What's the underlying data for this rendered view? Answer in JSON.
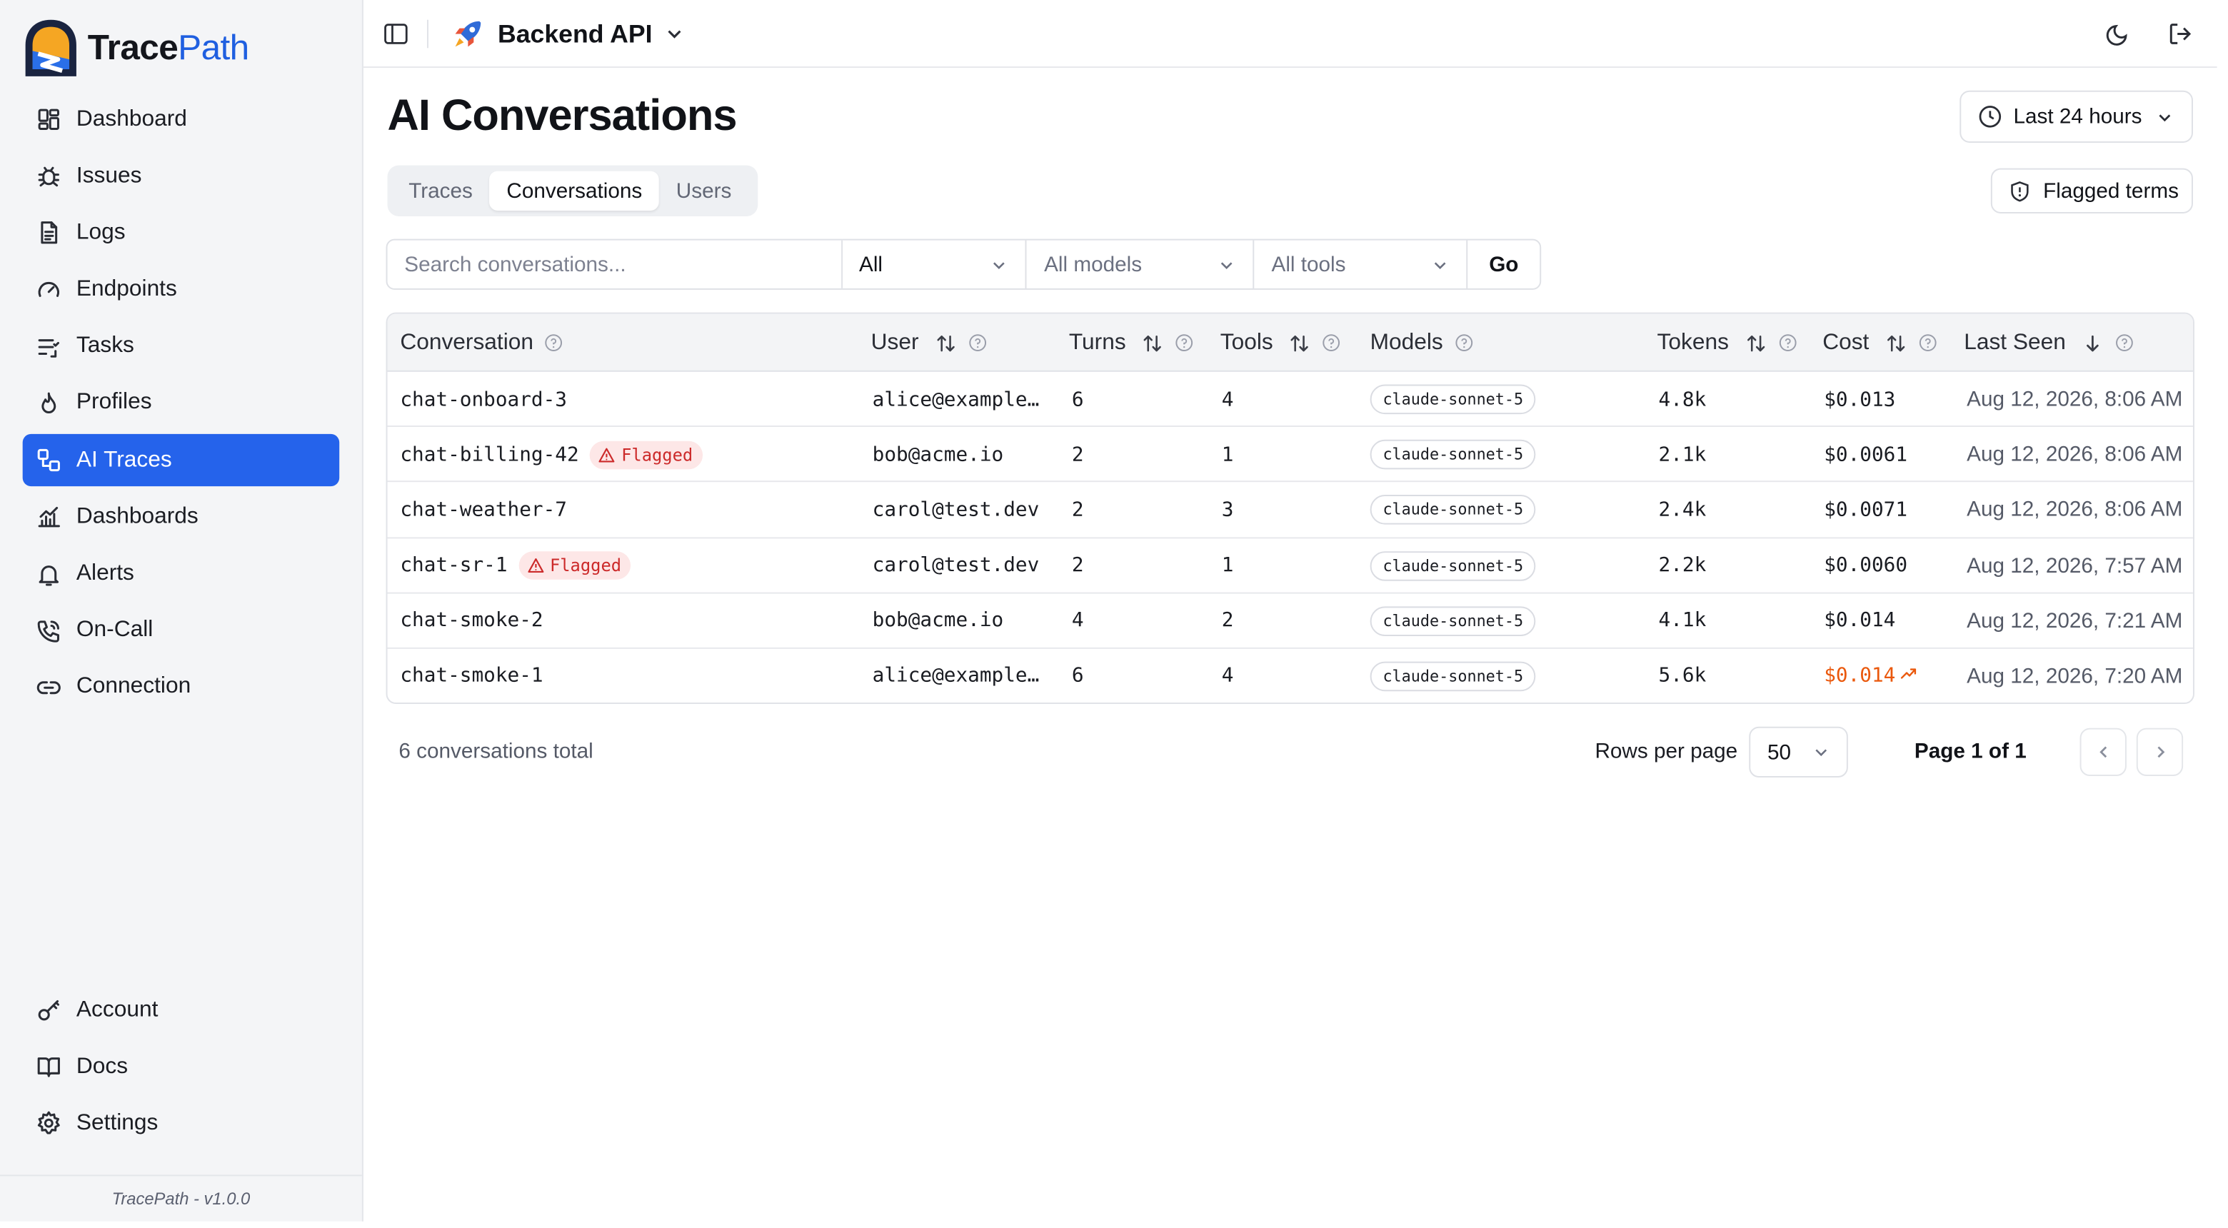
{
  "app": {
    "name_part1": "Trace",
    "name_part2": "Path",
    "version": "TracePath - v1.0.0"
  },
  "sidebar": {
    "items": [
      {
        "label": "Dashboard",
        "icon": "grid-icon"
      },
      {
        "label": "Issues",
        "icon": "bug-icon"
      },
      {
        "label": "Logs",
        "icon": "file-text-icon"
      },
      {
        "label": "Endpoints",
        "icon": "gauge-icon"
      },
      {
        "label": "Tasks",
        "icon": "list-checks-icon"
      },
      {
        "label": "Profiles",
        "icon": "flame-icon"
      },
      {
        "label": "AI Traces",
        "icon": "workflow-icon",
        "active": true
      },
      {
        "label": "Dashboards",
        "icon": "chart-line-icon"
      },
      {
        "label": "Alerts",
        "icon": "bell-icon"
      },
      {
        "label": "On-Call",
        "icon": "phone-icon"
      },
      {
        "label": "Connection",
        "icon": "link-icon"
      }
    ],
    "bottom_items": [
      {
        "label": "Account",
        "icon": "key-icon"
      },
      {
        "label": "Docs",
        "icon": "book-icon"
      },
      {
        "label": "Settings",
        "icon": "gear-icon"
      }
    ]
  },
  "topbar": {
    "project": "Backend API"
  },
  "page": {
    "title": "AI Conversations",
    "time_range": "Last 24 hours",
    "tabs": [
      {
        "label": "Traces",
        "active": false
      },
      {
        "label": "Conversations",
        "active": true
      },
      {
        "label": "Users",
        "active": false
      }
    ],
    "flagged_terms": "Flagged terms"
  },
  "filters": {
    "search_placeholder": "Search conversations...",
    "status": "All",
    "models": "All models",
    "tools": "All tools",
    "go": "Go"
  },
  "table": {
    "columns": [
      "Conversation",
      "User",
      "Turns",
      "Tools",
      "Models",
      "Tokens",
      "Cost",
      "Last Seen"
    ],
    "rows": [
      {
        "conversation": "chat-onboard-3",
        "flagged": false,
        "user": "alice@example…",
        "turns": "6",
        "tools": "4",
        "model": "claude-sonnet-5",
        "tokens": "4.8k",
        "cost": "$0.013",
        "cost_trend_up": false,
        "last_seen": "Aug 12, 2026, 8:06 AM"
      },
      {
        "conversation": "chat-billing-42",
        "flagged": true,
        "user": "bob@acme.io",
        "turns": "2",
        "tools": "1",
        "model": "claude-sonnet-5",
        "tokens": "2.1k",
        "cost": "$0.0061",
        "cost_trend_up": false,
        "last_seen": "Aug 12, 2026, 8:06 AM"
      },
      {
        "conversation": "chat-weather-7",
        "flagged": false,
        "user": "carol@test.dev",
        "turns": "2",
        "tools": "3",
        "model": "claude-sonnet-5",
        "tokens": "2.4k",
        "cost": "$0.0071",
        "cost_trend_up": false,
        "last_seen": "Aug 12, 2026, 8:06 AM"
      },
      {
        "conversation": "chat-sr-1",
        "flagged": true,
        "user": "carol@test.dev",
        "turns": "2",
        "tools": "1",
        "model": "claude-sonnet-5",
        "tokens": "2.2k",
        "cost": "$0.0060",
        "cost_trend_up": false,
        "last_seen": "Aug 12, 2026, 7:57 AM"
      },
      {
        "conversation": "chat-smoke-2",
        "flagged": false,
        "user": "bob@acme.io",
        "turns": "4",
        "tools": "2",
        "model": "claude-sonnet-5",
        "tokens": "4.1k",
        "cost": "$0.014",
        "cost_trend_up": false,
        "last_seen": "Aug 12, 2026, 7:21 AM"
      },
      {
        "conversation": "chat-smoke-1",
        "flagged": false,
        "user": "alice@example…",
        "turns": "6",
        "tools": "4",
        "model": "claude-sonnet-5",
        "tokens": "5.6k",
        "cost": "$0.014",
        "cost_trend_up": true,
        "last_seen": "Aug 12, 2026, 7:20 AM"
      }
    ],
    "flag_label": "Flagged"
  },
  "pagination": {
    "total": "6 conversations total",
    "rows_per_page_label": "Rows per page",
    "rows_per_page": "50",
    "page": "Page 1 of 1"
  },
  "colors": {
    "accent": "#2563eb",
    "flag_bg": "#fde7e7",
    "flag_text": "#cc2a2a",
    "cost_up": "#ea580c"
  }
}
